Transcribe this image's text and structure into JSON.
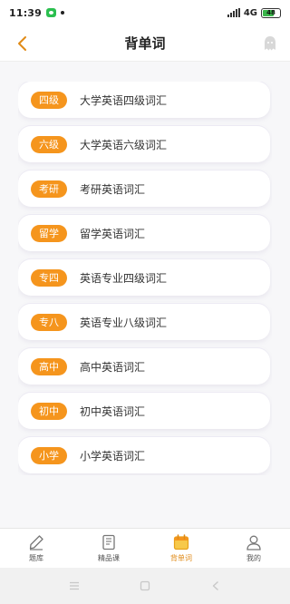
{
  "status_bar": {
    "time": "11:39",
    "network": "4G",
    "battery": "48"
  },
  "header": {
    "title": "背单词"
  },
  "vocab_list": [
    {
      "tag": "四级",
      "label": "大学英语四级词汇"
    },
    {
      "tag": "六级",
      "label": "大学英语六级词汇"
    },
    {
      "tag": "考研",
      "label": "考研英语词汇"
    },
    {
      "tag": "留学",
      "label": "留学英语词汇"
    },
    {
      "tag": "专四",
      "label": "英语专业四级词汇"
    },
    {
      "tag": "专八",
      "label": "英语专业八级词汇"
    },
    {
      "tag": "高中",
      "label": "高中英语词汇"
    },
    {
      "tag": "初中",
      "label": "初中英语词汇"
    },
    {
      "tag": "小学",
      "label": "小学英语词汇"
    }
  ],
  "bottom_nav": [
    {
      "label": "题库",
      "icon": "pencil-icon",
      "active": false
    },
    {
      "label": "精品课",
      "icon": "book-icon",
      "active": false
    },
    {
      "label": "背单词",
      "icon": "calendar-icon",
      "active": true
    },
    {
      "label": "我的",
      "icon": "user-icon",
      "active": false
    }
  ],
  "colors": {
    "accent": "#f5951d",
    "back_arrow": "#e08a16"
  }
}
